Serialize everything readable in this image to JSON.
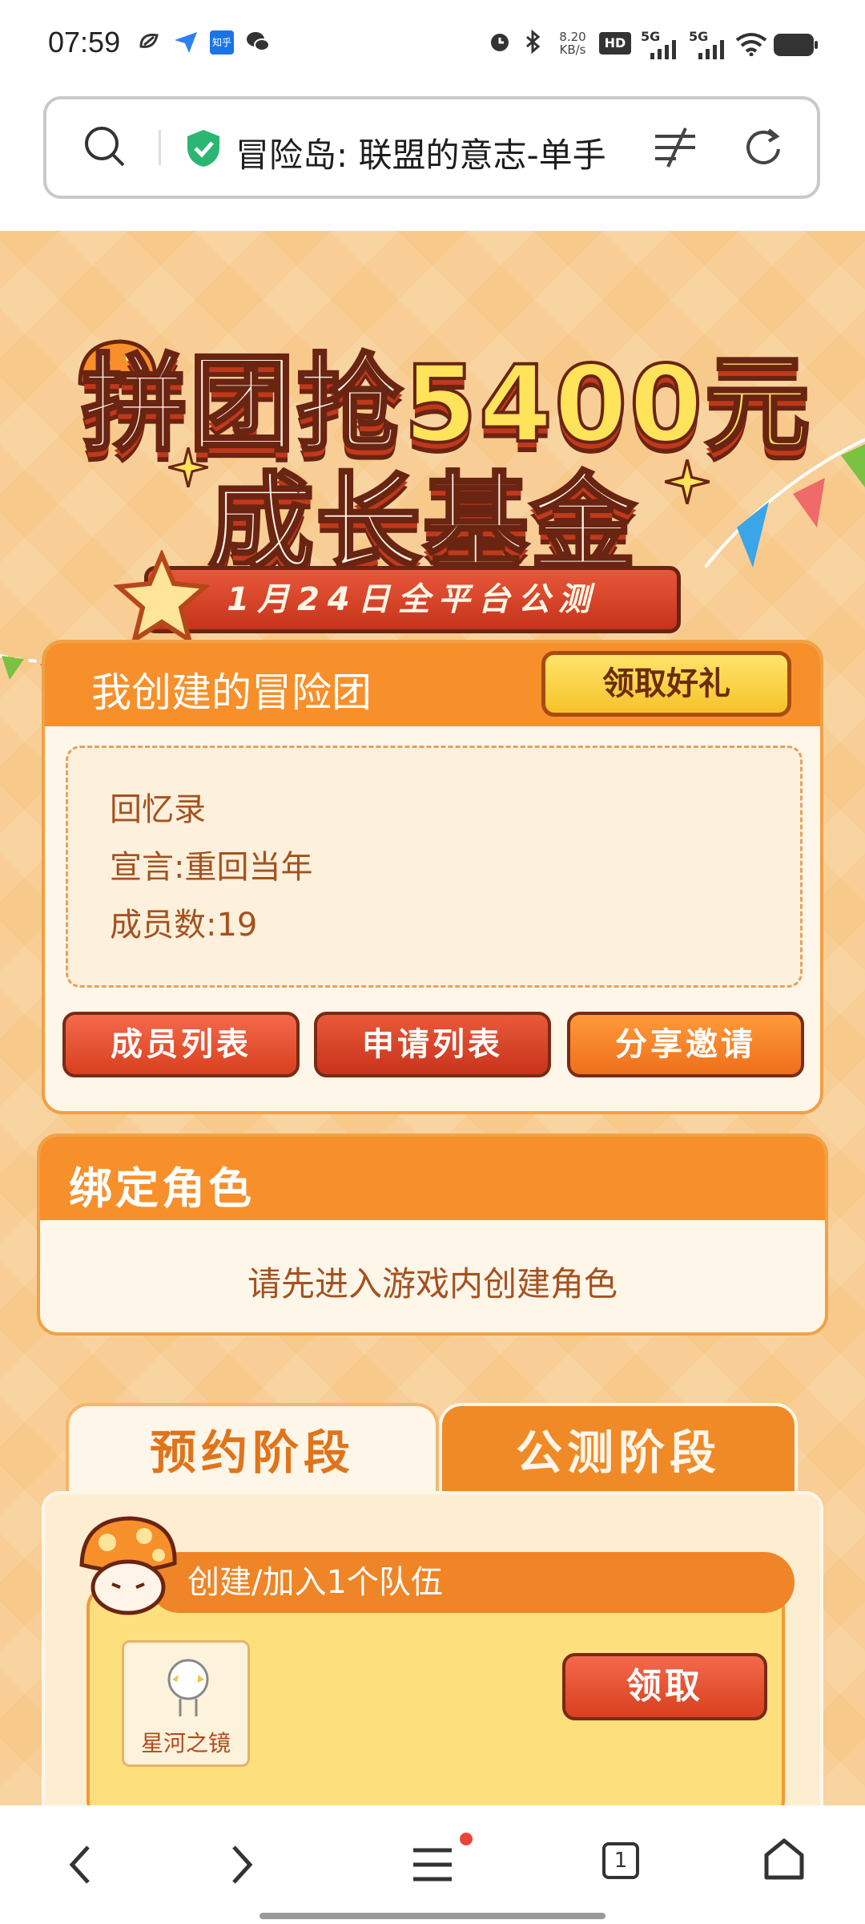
{
  "status_bar": {
    "time": "07:59",
    "net_speed_top": "8.20",
    "net_speed_bottom": "KB/s",
    "hd_label": "HD",
    "sim1": "5G",
    "sim2": "5G",
    "zhihu_label": "知乎",
    "icons": [
      "app-icon",
      "send-icon",
      "zhihu-icon",
      "wechat-icon",
      "alarm-icon",
      "bluetooth-icon",
      "hd-icon",
      "signal-icon",
      "signal-icon",
      "wifi-icon",
      "battery-icon"
    ]
  },
  "browser": {
    "title": "冒险岛: 联盟的意志-单手"
  },
  "banner": {
    "line1_prefix": "拼团抢",
    "line1_amount": "5400元",
    "line2": "成长基金",
    "ribbon": "1月24日全平台公测"
  },
  "team_card": {
    "title": "我创建的冒险团",
    "gift_button": "领取好礼",
    "team_name": "回忆录",
    "declaration": "宣言:重回当年",
    "members": "成员数:19",
    "buttons": [
      "成员列表",
      "申请列表",
      "分享邀请"
    ]
  },
  "bind_card": {
    "title": "绑定角色",
    "message": "请先进入游戏内创建角色"
  },
  "stages": {
    "tabs": [
      "预约阶段",
      "公测阶段"
    ],
    "active_tab": 0,
    "task": {
      "title": "创建/加入1个队伍",
      "reward_name": "星河之镜",
      "claim_button": "领取"
    }
  },
  "bottom_nav": {
    "tab_count": "1",
    "icons": [
      "back-icon",
      "forward-icon",
      "menu-icon",
      "tabs-icon",
      "home-icon"
    ]
  },
  "colors": {
    "page_bg": "#f7c98a",
    "header_orange": "#f7902a",
    "button_red": "#d8401f",
    "button_yellow": "#f7c22a",
    "text_brown": "#a4521f"
  }
}
